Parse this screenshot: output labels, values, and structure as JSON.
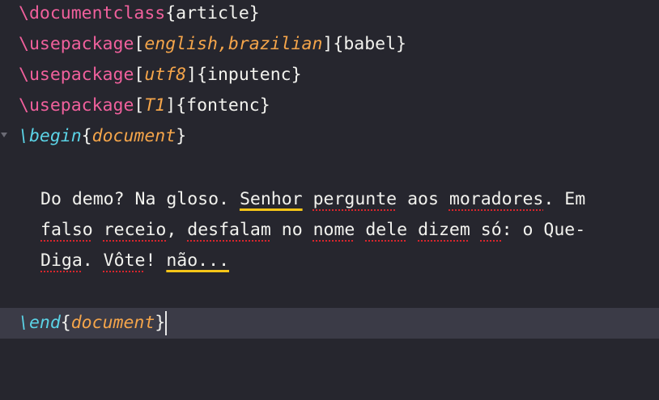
{
  "editor": {
    "lines": [
      {
        "cmd": "\\documentclass",
        "arg": "article"
      },
      {
        "cmd": "\\usepackage",
        "opt": "english,brazilian",
        "arg": "babel"
      },
      {
        "cmd": "\\usepackage",
        "opt": "utf8",
        "arg": "inputenc"
      },
      {
        "cmd": "\\usepackage",
        "opt": "T1",
        "arg": "fontenc"
      },
      {
        "cmd": "\\begin",
        "arg": "document"
      }
    ],
    "body": {
      "l1": [
        "Do demo? Na gloso. ",
        "Senhor",
        " ",
        "pergunte",
        " aos ",
        "moradores",
        ". Em"
      ],
      "l2": [
        "falso",
        " ",
        "receio",
        ", ",
        "desfalam",
        " no ",
        "nome",
        " ",
        "dele",
        " ",
        "dizem",
        " ",
        "só",
        ": o Que-"
      ],
      "l3": [
        "Diga",
        ". ",
        "Vôte",
        "! ",
        "não..."
      ]
    },
    "end": {
      "cmd": "\\end",
      "arg": "document"
    },
    "bracket_open": "[",
    "bracket_close": "]",
    "brace_open": "{",
    "brace_close": "}"
  }
}
